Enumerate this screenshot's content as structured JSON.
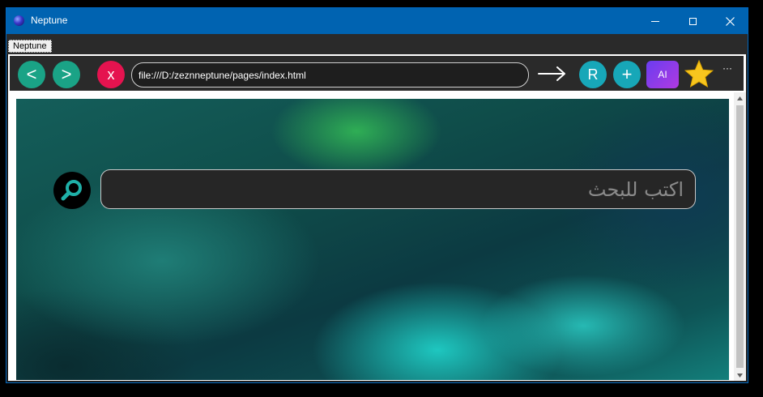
{
  "window": {
    "title": "Neptune"
  },
  "tabs": [
    {
      "label": "Neptune"
    }
  ],
  "toolbar": {
    "back_label": "<",
    "forward_label": ">",
    "stop_label": "x",
    "url": "file:///D:/zeznneptune/pages/index.html",
    "reload_label": "R",
    "new_tab_label": "+",
    "ai_label": "AI",
    "more_label": "···"
  },
  "page": {
    "search_placeholder": "اكتب للبحث"
  },
  "colors": {
    "titlebar": "#0063b1",
    "nav_button": "#1aa386",
    "stop_button": "#e5134f",
    "action_button": "#17a7b8",
    "star": "#f7c51e"
  }
}
